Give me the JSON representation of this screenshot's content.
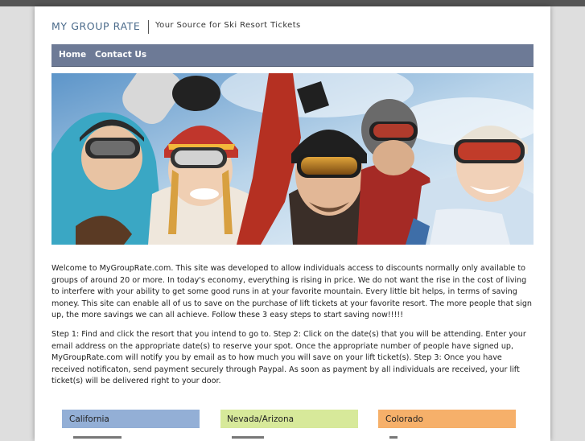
{
  "header": {
    "site_title": "MY GROUP RATE",
    "tagline": "Your Source for Ski Resort Tickets"
  },
  "nav": {
    "items": [
      "Home",
      "Contact Us"
    ],
    "background": "#6d7a96"
  },
  "content": {
    "intro": "Welcome to MyGroupRate.com. This site was developed to allow individuals access to discounts normally only available to groups of around 20 or more. In today's economy, everything is rising in price. We do not want the rise in the cost of living to interfere with your ability to get some good runs in at your favorite mountain. Every little bit helps, in terms of saving money. This site can enable all of us to save on the purchase of lift tickets at your favorite resort. The more people that sign up, the more savings we can all achieve. Follow these 3 easy steps to start saving now!!!!!",
    "steps": "Step 1: Find and click the resort that you intend to go to. Step 2: Click on the date(s) that you will be attending. Enter your email address on the appropriate date(s) to reserve your spot. Once the appropriate number of people have signed up, MyGroupRate.com will notify you by email as to how much you will save on your lift ticket(s). Step 3: Once you have received notificaton, send payment securely through Paypal. As soon as payment by all individuals are received, your lift ticket(s) will be delivered right to your door."
  },
  "regions": [
    {
      "label": "California",
      "color": "#93afd6"
    },
    {
      "label": "Nevada/Arizona",
      "color": "#d7e99a"
    },
    {
      "label": "Colorado",
      "color": "#f6b06a"
    }
  ]
}
